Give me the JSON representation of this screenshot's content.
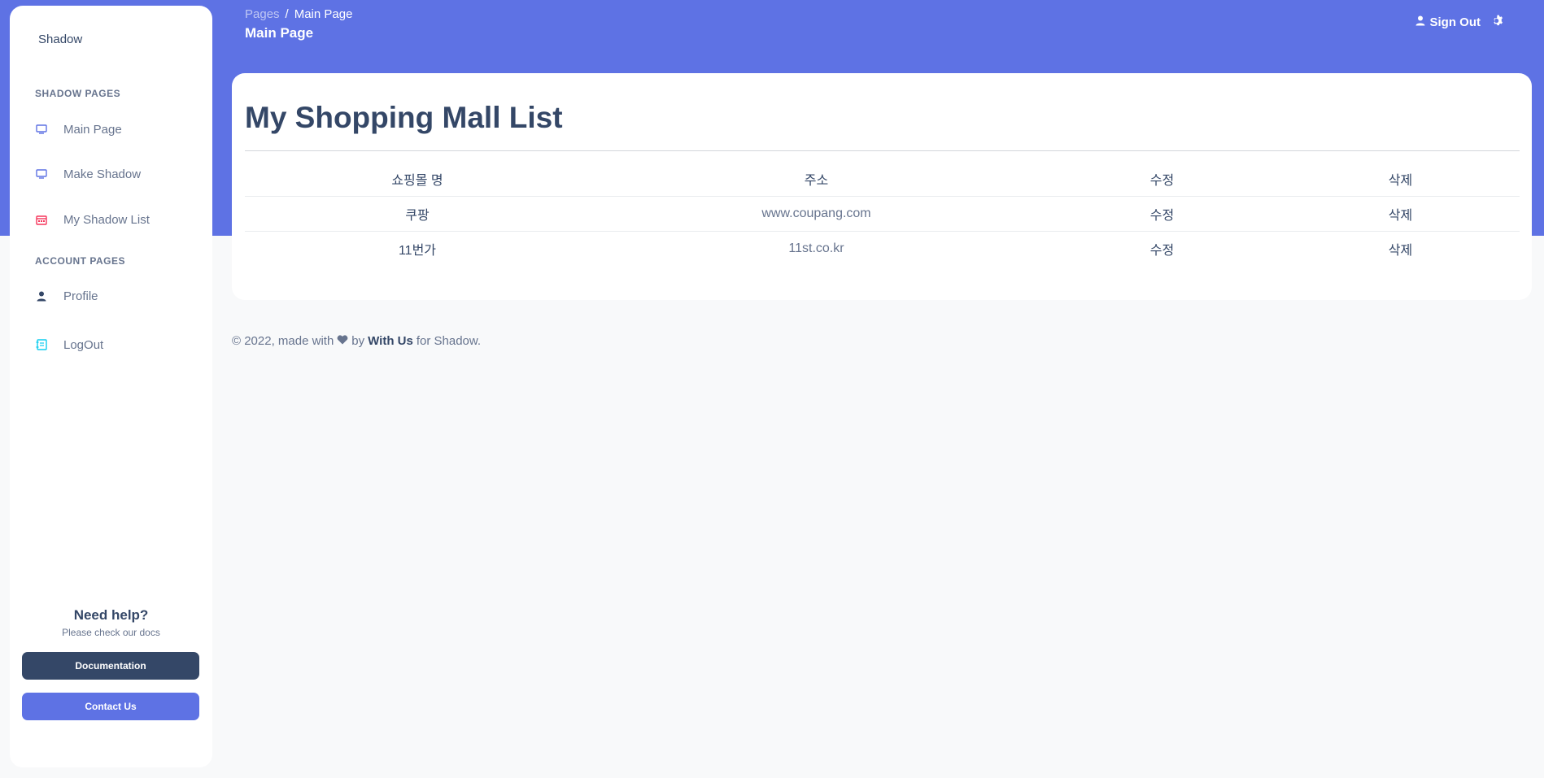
{
  "sidebar": {
    "brand": "Shadow",
    "section_shadow": "SHADOW PAGES",
    "section_account": "ACCOUNT PAGES",
    "items": [
      {
        "label": "Main Page",
        "icon": "monitor-icon",
        "color": "#5e72e4"
      },
      {
        "label": "Make Shadow",
        "icon": "monitor-icon",
        "color": "#5e72e4"
      },
      {
        "label": "My Shadow List",
        "icon": "calendar-icon",
        "color": "#f5365c"
      },
      {
        "label": "Profile",
        "icon": "user-icon",
        "color": "#344767"
      },
      {
        "label": "LogOut",
        "icon": "document-icon",
        "color": "#11cdef"
      }
    ],
    "help": {
      "title": "Need help?",
      "subtitle": "Please check our docs",
      "docs_button": "Documentation",
      "contact_button": "Contact Us"
    }
  },
  "header": {
    "breadcrumb_root": "Pages",
    "breadcrumb_sep": "/",
    "breadcrumb_current": "Main Page",
    "title": "Main Page",
    "sign_out": "Sign Out"
  },
  "main": {
    "heading": "My Shopping Mall List",
    "columns": [
      "쇼핑몰 명",
      "주소",
      "수정",
      "삭제"
    ],
    "rows": [
      {
        "name": "쿠팡",
        "url": "www.coupang.com",
        "edit": "수정",
        "delete": "삭제"
      },
      {
        "name": "11번가",
        "url": "11st.co.kr",
        "edit": "수정",
        "delete": "삭제"
      }
    ]
  },
  "footer": {
    "prefix": "© 2022, made with",
    "by": "by",
    "author": "With Us",
    "suffix": "for Shadow."
  },
  "colors": {
    "primary": "#5e72e4",
    "dark": "#344767",
    "background": "#f8f9fa"
  }
}
